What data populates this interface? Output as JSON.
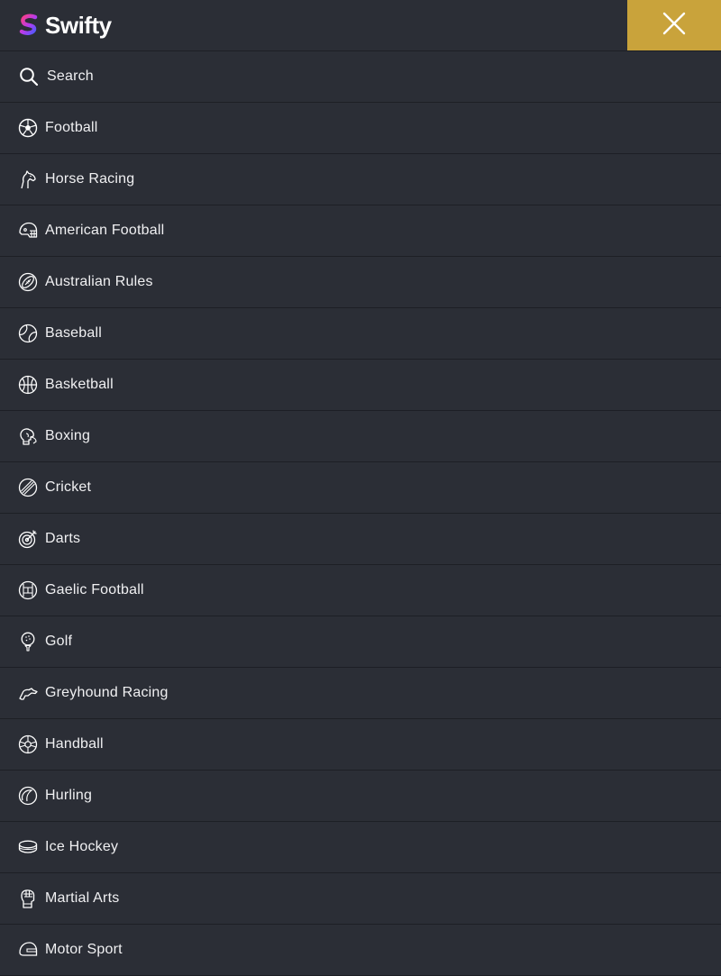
{
  "header": {
    "brand": "Swifty",
    "logo_icon": "swifty-s-logo",
    "close_icon": "close-icon",
    "accent_color": "#c9a33b"
  },
  "search": {
    "label": "Search",
    "icon": "search-icon"
  },
  "menu": {
    "items": [
      {
        "label": "Football",
        "icon": "soccer-ball-icon"
      },
      {
        "label": "Horse Racing",
        "icon": "horse-head-icon"
      },
      {
        "label": "American Football",
        "icon": "football-helmet-icon"
      },
      {
        "label": "Australian Rules",
        "icon": "rugby-ball-icon"
      },
      {
        "label": "Baseball",
        "icon": "baseball-icon"
      },
      {
        "label": "Basketball",
        "icon": "basketball-icon"
      },
      {
        "label": "Boxing",
        "icon": "boxing-glove-icon"
      },
      {
        "label": "Cricket",
        "icon": "cricket-ball-icon"
      },
      {
        "label": "Darts",
        "icon": "dartboard-icon"
      },
      {
        "label": "Gaelic Football",
        "icon": "gaelic-ball-icon"
      },
      {
        "label": "Golf",
        "icon": "golf-ball-on-tee-icon"
      },
      {
        "label": "Greyhound Racing",
        "icon": "greyhound-icon"
      },
      {
        "label": "Handball",
        "icon": "handball-icon"
      },
      {
        "label": "Hurling",
        "icon": "sliotar-icon"
      },
      {
        "label": "Ice Hockey",
        "icon": "hockey-puck-icon"
      },
      {
        "label": "Martial Arts",
        "icon": "mma-glove-icon"
      },
      {
        "label": "Motor Sport",
        "icon": "racing-helmet-icon"
      }
    ]
  }
}
